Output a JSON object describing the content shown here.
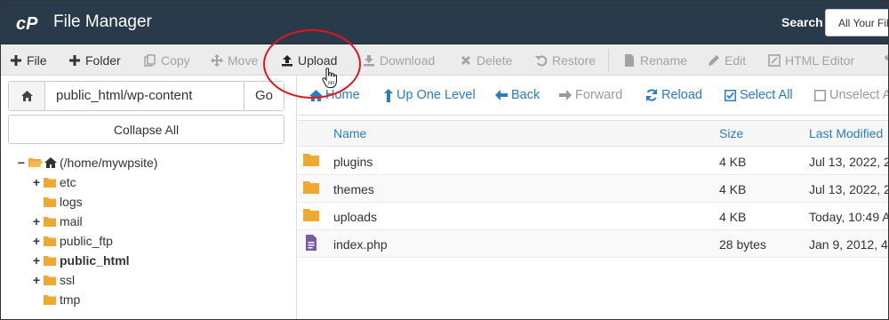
{
  "header": {
    "app_title": "File Manager",
    "search_label": "Search",
    "search_scope": "All Your Fil",
    "bg_color": "#293a4a"
  },
  "toolbar": {
    "items": [
      {
        "label": "File",
        "icon": "plus-icon",
        "enabled": true
      },
      {
        "label": "Folder",
        "icon": "plus-icon",
        "enabled": true
      },
      {
        "label": "Copy",
        "icon": "copy-icon",
        "enabled": false
      },
      {
        "label": "Move",
        "icon": "move-icon",
        "enabled": false
      },
      {
        "label": "Upload",
        "icon": "upload-icon",
        "enabled": true
      },
      {
        "label": "Download",
        "icon": "download-icon",
        "enabled": false
      },
      {
        "label": "Delete",
        "icon": "delete-icon",
        "enabled": false
      },
      {
        "label": "Restore",
        "icon": "restore-icon",
        "enabled": false
      },
      {
        "label": "Rename",
        "icon": "file-icon",
        "enabled": false
      },
      {
        "label": "Edit",
        "icon": "pencil-icon",
        "enabled": false
      },
      {
        "label": "HTML Editor",
        "icon": "html-editor-icon",
        "enabled": false
      }
    ]
  },
  "left": {
    "path_value": "public_html/wp-content",
    "go_label": "Go",
    "collapse_label": "Collapse All",
    "tree": [
      {
        "label": "(/home/mywpsite)",
        "expander": "−",
        "bold": false,
        "icon": "home-icon"
      },
      {
        "label": "etc",
        "expander": "+",
        "bold": false,
        "icon": "folder-icon"
      },
      {
        "label": "logs",
        "expander": "",
        "bold": false,
        "icon": "folder-icon"
      },
      {
        "label": "mail",
        "expander": "+",
        "bold": false,
        "icon": "folder-icon"
      },
      {
        "label": "public_ftp",
        "expander": "+",
        "bold": false,
        "icon": "folder-icon"
      },
      {
        "label": "public_html",
        "expander": "+",
        "bold": true,
        "icon": "folder-icon"
      },
      {
        "label": "ssl",
        "expander": "+",
        "bold": false,
        "icon": "folder-icon"
      },
      {
        "label": "tmp",
        "expander": "",
        "bold": false,
        "icon": "folder-icon"
      }
    ]
  },
  "nav": {
    "items": [
      {
        "label": "Home",
        "icon": "home-icon",
        "enabled": true
      },
      {
        "label": "Up One Level",
        "icon": "up-arrow-icon",
        "enabled": true
      },
      {
        "label": "Back",
        "icon": "back-arrow-icon",
        "enabled": true
      },
      {
        "label": "Forward",
        "icon": "forward-arrow-icon",
        "enabled": false
      },
      {
        "label": "Reload",
        "icon": "reload-icon",
        "enabled": true
      },
      {
        "label": "Select All",
        "icon": "checkbox-checked-icon",
        "enabled": true
      },
      {
        "label": "Unselect A",
        "icon": "checkbox-empty-icon",
        "enabled": false
      }
    ]
  },
  "files": {
    "columns": {
      "name": "Name",
      "size": "Size",
      "modified": "Last Modified"
    },
    "rows": [
      {
        "name": "plugins",
        "size": "4 KB",
        "modified": "Jul 13, 2022, 2",
        "type": "folder"
      },
      {
        "name": "themes",
        "size": "4 KB",
        "modified": "Jul 13, 2022, 2",
        "type": "folder"
      },
      {
        "name": "uploads",
        "size": "4 KB",
        "modified": "Today, 10:49 A",
        "type": "folder"
      },
      {
        "name": "index.php",
        "size": "28 bytes",
        "modified": "Jan 9, 2012, 4",
        "type": "php"
      }
    ]
  },
  "colors": {
    "link_blue": "#2b7bc4",
    "folder_orange": "#f0a830",
    "php_purple": "#7b5aa6",
    "annotation_red": "#e0161d"
  }
}
